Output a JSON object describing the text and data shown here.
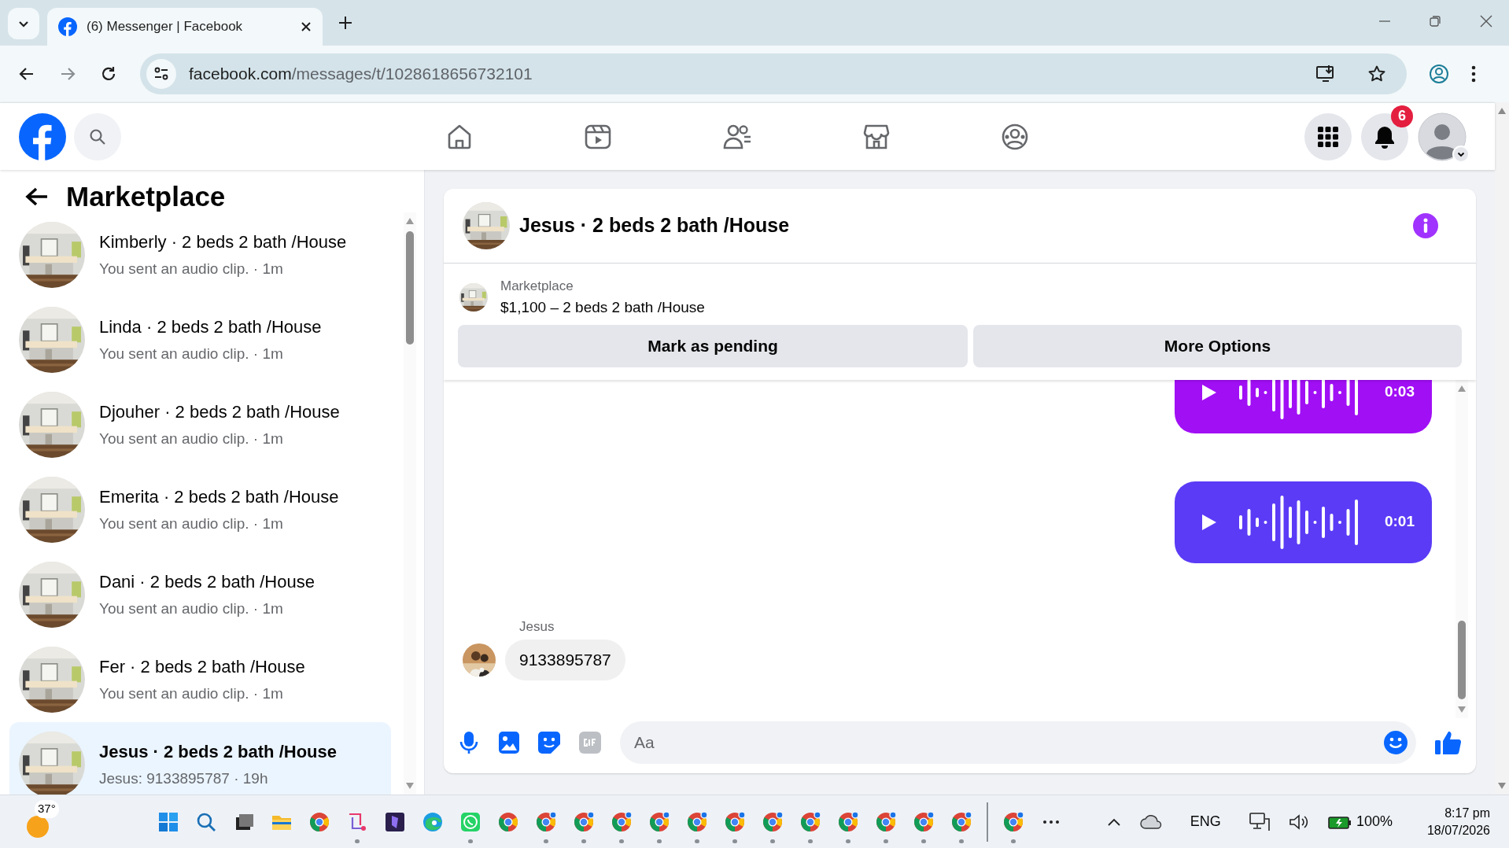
{
  "browser": {
    "tab_title": "(6) Messenger | Facebook",
    "address_host": "facebook.com",
    "address_path": "/messages/t/1028618656732101"
  },
  "header": {
    "notification_count": "6"
  },
  "sidebar": {
    "title": "Marketplace",
    "conversations": [
      {
        "name": "Kimberly · 2 beds 2 bath /House",
        "preview": "You sent an audio clip. · 1m",
        "selected": false
      },
      {
        "name": "Linda · 2 beds 2 bath /House",
        "preview": "You sent an audio clip. · 1m",
        "selected": false
      },
      {
        "name": "Djouher · 2 beds 2 bath /House",
        "preview": "You sent an audio clip. · 1m",
        "selected": false
      },
      {
        "name": "Emerita · 2 beds 2 bath /House",
        "preview": "You sent an audio clip. · 1m",
        "selected": false
      },
      {
        "name": "Dani · 2 beds 2 bath /House",
        "preview": "You sent an audio clip. · 1m",
        "selected": false
      },
      {
        "name": "Fer · 2 beds 2 bath /House",
        "preview": "You sent an audio clip. · 1m",
        "selected": false
      },
      {
        "name": "Jesus · 2 beds 2 bath /House",
        "preview": "Jesus: 9133895787 · 19h",
        "selected": true
      }
    ]
  },
  "chat": {
    "title": "Jesus · 2 beds 2 bath /House",
    "listing": {
      "label": "Marketplace",
      "price_title": "$1,100 – 2 beds 2 bath /House"
    },
    "actions": [
      "Mark as pending",
      "More Options"
    ],
    "messages": [
      {
        "kind": "audio",
        "duration": "0:03",
        "color": "#a10ff5"
      },
      {
        "kind": "audio",
        "duration": "0:01",
        "color": "#5b3bf6"
      },
      {
        "kind": "text",
        "sender": "Jesus",
        "text": "9133895787"
      }
    ],
    "composer": {
      "placeholder": "Aa"
    }
  },
  "taskbar": {
    "weather": "37°",
    "apps": [
      {
        "kind": "windows",
        "running": false
      },
      {
        "kind": "search",
        "running": false
      },
      {
        "kind": "taskview",
        "running": false
      },
      {
        "kind": "files",
        "running": false
      },
      {
        "kind": "chrome",
        "running": false
      },
      {
        "kind": "snip",
        "running": true
      },
      {
        "kind": "app",
        "running": false
      },
      {
        "kind": "edge",
        "running": false
      },
      {
        "kind": "whatsapp",
        "running": true
      },
      {
        "kind": "chrome",
        "running": false
      },
      {
        "kind": "profile",
        "running": true
      },
      {
        "kind": "profile",
        "running": true
      },
      {
        "kind": "profile",
        "running": true
      },
      {
        "kind": "profile",
        "running": true
      },
      {
        "kind": "profile",
        "running": true
      },
      {
        "kind": "profile",
        "running": true
      },
      {
        "kind": "profile",
        "running": true
      },
      {
        "kind": "profile",
        "running": true
      },
      {
        "kind": "profile",
        "running": true
      },
      {
        "kind": "profile",
        "running": true
      },
      {
        "kind": "profile",
        "running": true
      },
      {
        "kind": "profile",
        "running": true
      },
      {
        "kind": "divider"
      },
      {
        "kind": "profile",
        "running": true
      },
      {
        "kind": "more",
        "running": false
      }
    ],
    "language": "ENG",
    "battery": "100%",
    "time": "8:17 pm",
    "date": "18/07/2026"
  }
}
